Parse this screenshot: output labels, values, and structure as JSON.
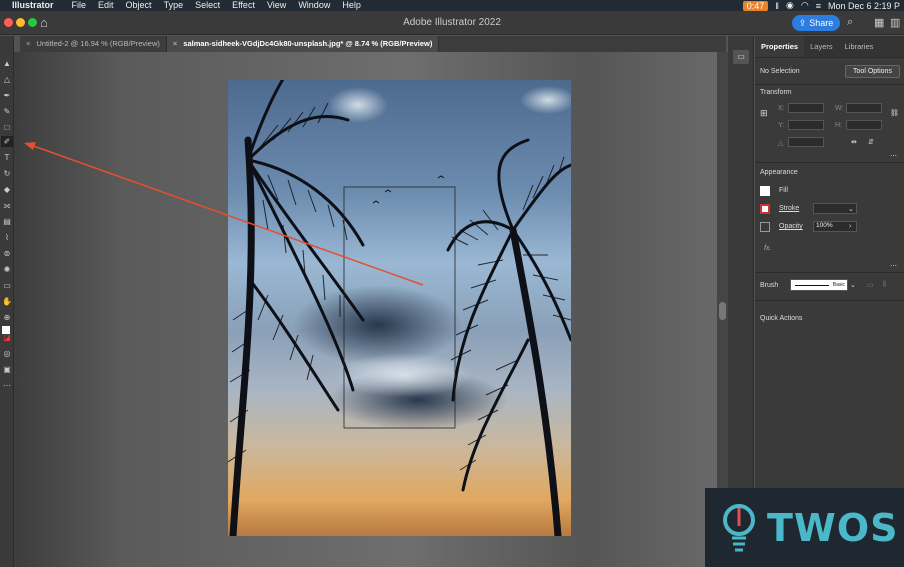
{
  "menubar": {
    "app_name": "Illustrator",
    "items": [
      "File",
      "Edit",
      "Object",
      "Type",
      "Select",
      "Effect",
      "View",
      "Window",
      "Help"
    ],
    "battery_time": "0:47",
    "clock": "Mon Dec 6  2:19 P"
  },
  "titlebar": {
    "title": "Adobe Illustrator 2022",
    "share_label": "Share"
  },
  "tabs": [
    {
      "label": "Untitled-2 @ 16.94 % (RGB/Preview)"
    },
    {
      "label": "salman-sidheek-VGdjDc4Gk80-unsplash.jpg* @ 8.74 % (RGB/Preview)"
    }
  ],
  "panel": {
    "tabs": [
      "Properties",
      "Layers",
      "Libraries"
    ],
    "selection": "No Selection",
    "tool_options": "Tool Options",
    "transform_title": "Transform",
    "appearance_title": "Appearance",
    "fill_label": "Fill",
    "stroke_label": "Stroke",
    "opacity_label": "Opacity",
    "opacity_value": "100%",
    "fx_label": "fx.",
    "brush_label": "Brush",
    "brush_value": "Basic",
    "quick_actions": "Quick Actions",
    "fields": {
      "x": "X:",
      "y": "Y:",
      "w": "W:",
      "h": "H:",
      "angle": "△"
    }
  },
  "watermark": {
    "text": "TWOS"
  },
  "colors": {
    "accent": "#2d7ce0",
    "arrow": "#e05030",
    "battery": "#e8832a"
  }
}
